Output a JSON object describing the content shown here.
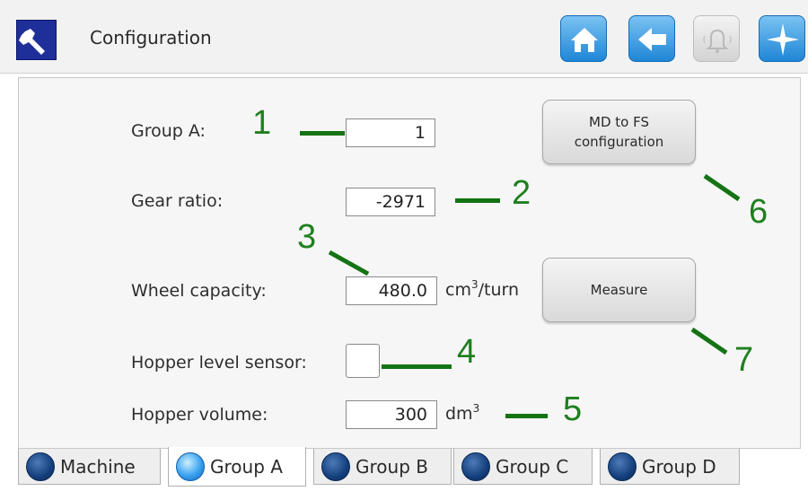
{
  "header": {
    "title": "Configuration",
    "buttons": [
      {
        "name": "home-button",
        "icon": "home-icon",
        "state": "active"
      },
      {
        "name": "back-button",
        "icon": "arrow-left-icon",
        "state": "active"
      },
      {
        "name": "alarm-button",
        "icon": "bell-icon",
        "state": "disabled"
      },
      {
        "name": "navigation-button",
        "icon": "compass-icon",
        "state": "active"
      }
    ],
    "app_icon": "wrench-icon"
  },
  "form": {
    "group_a_label": "Group A:",
    "group_a_value": "1",
    "gear_ratio_label": "Gear ratio:",
    "gear_ratio_value": "-2971",
    "wheel_capacity_label": "Wheel capacity:",
    "wheel_capacity_value": "480.0",
    "wheel_capacity_unit_base": "cm",
    "wheel_capacity_unit_exp": "3",
    "wheel_capacity_unit_suffix": "/turn",
    "hopper_sensor_label": "Hopper level sensor:",
    "hopper_sensor_checked": false,
    "hopper_volume_label": "Hopper volume:",
    "hopper_volume_value": "300",
    "hopper_volume_unit_base": "dm",
    "hopper_volume_unit_exp": "3"
  },
  "buttons": {
    "md_to_fs_line1": "MD to FS",
    "md_to_fs_line2": "configuration",
    "measure": "Measure"
  },
  "annotations": [
    "1",
    "2",
    "3",
    "4",
    "5",
    "6",
    "7"
  ],
  "tabs": [
    {
      "label": "Machine",
      "active": false
    },
    {
      "label": "Group A",
      "active": true
    },
    {
      "label": "Group B",
      "active": false
    },
    {
      "label": "Group C",
      "active": false
    },
    {
      "label": "Group D",
      "active": false
    }
  ],
  "colors": {
    "accent_blue": "#1f86d6",
    "app_icon_bg": "#1f2f9a",
    "annotation_green": "#1e7f1e"
  }
}
